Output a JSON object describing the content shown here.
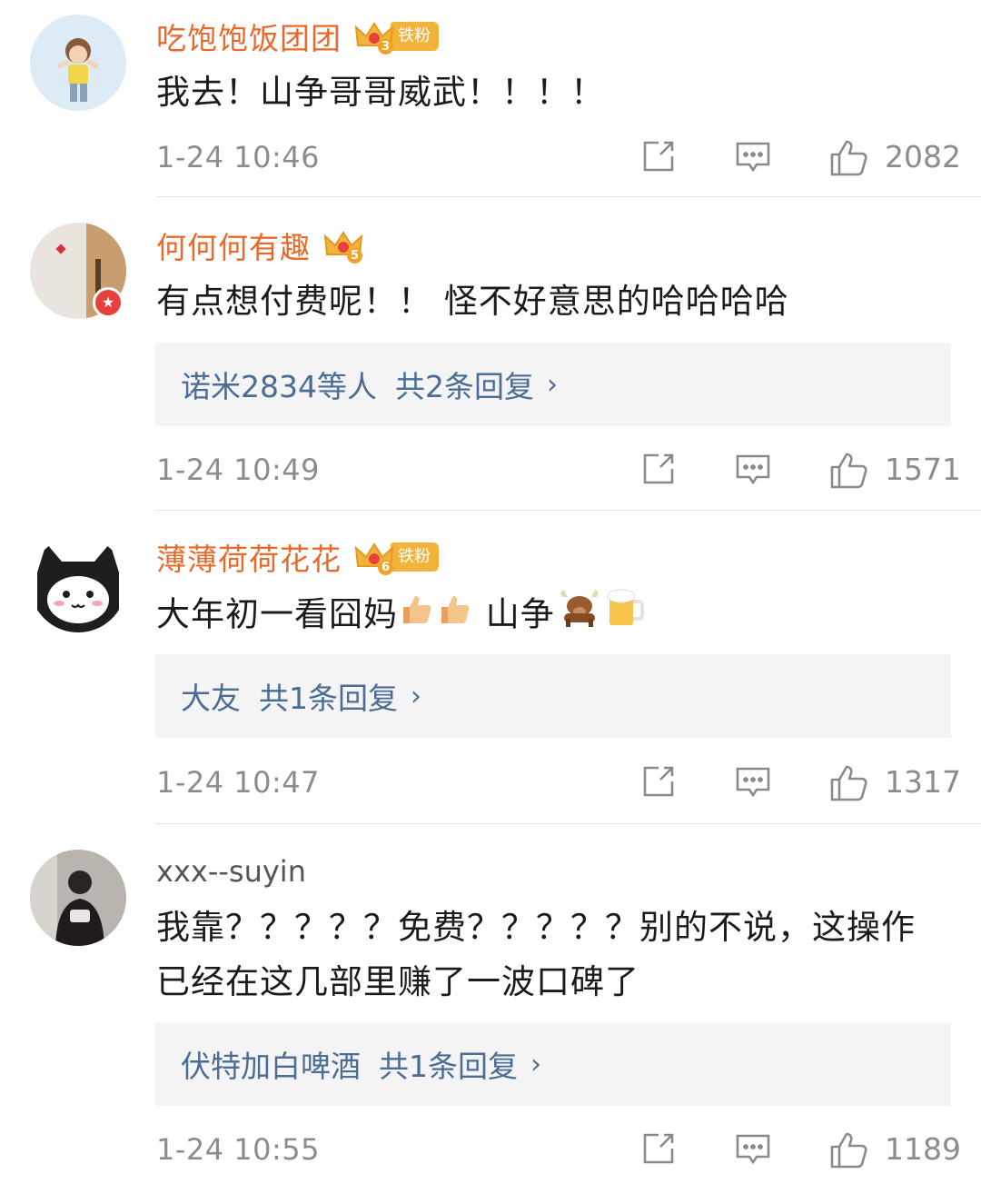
{
  "comments": [
    {
      "username": "吃饱饱饭团团",
      "crown_level": "3",
      "fan_badge": "铁粉",
      "text": "我去！山争哥哥威武！！！！",
      "time": "1-24 10:46",
      "likes": "2082"
    },
    {
      "username": "何何何有趣",
      "crown_level": "5",
      "text": "有点想付费呢！！ 怪不好意思的哈哈哈哈",
      "reply": {
        "users": "诺米2834等人",
        "count": "共2条回复",
        "chevron": "›"
      },
      "time": "1-24 10:49",
      "likes": "1571"
    },
    {
      "username": "薄薄荷荷花花",
      "crown_level": "6",
      "fan_badge": "铁粉",
      "text_before": "大年初一看囧妈",
      "text_mid": "山争",
      "emojis": [
        "thumbs-up-icon",
        "thumbs-up-icon",
        "ox-icon",
        "beer-mug-icon"
      ],
      "reply": {
        "users": "大友",
        "count": "共1条回复",
        "chevron": "›"
      },
      "time": "1-24 10:47",
      "likes": "1317"
    },
    {
      "username": "xxx--suyin",
      "text": "我靠？？？？？免费？？？？？别的不说，这操作已经在这几部里赚了一波口碑了",
      "reply": {
        "users": "伏特加白啤酒",
        "count": "共1条回复",
        "chevron": "›"
      },
      "time": "1-24 10:55",
      "likes": "1189"
    }
  ],
  "actions": [
    "share-icon",
    "comment-icon",
    "like-icon"
  ],
  "colors": {
    "username": "#e86a2a",
    "reply_link": "#4a6c95",
    "meta_gray": "#8c8c8c",
    "reply_bg": "#f4f4f4",
    "crown_gold": "#f3b33a"
  }
}
